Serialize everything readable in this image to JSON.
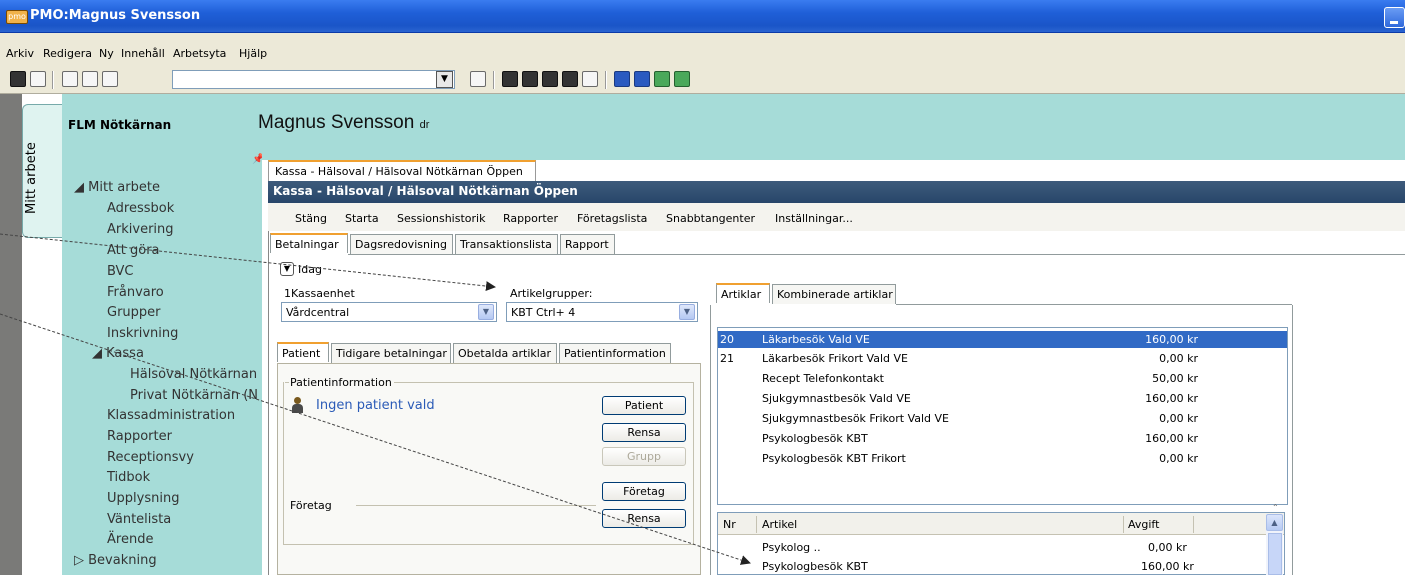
{
  "window": {
    "title": "PMO:Magnus Svensson",
    "icon_text": "pmo"
  },
  "menubar": [
    "Arkiv",
    "Redigera",
    "Ny",
    "Innehåll",
    "Arbetsyta",
    "Hjälp"
  ],
  "side_tab": {
    "label": "Mitt arbete"
  },
  "nav": {
    "header": "FLM Nötkärnan",
    "items": [
      "Mitt arbete",
      "Adressbok",
      "Arkivering",
      "Att göra",
      "BVC",
      "Frånvaro",
      "Grupper",
      "Inskrivning",
      "Kassa",
      "Hälsoval Nötkärnan",
      "Privat Nötkärnan (N",
      "Klassadministration",
      "Rapporter",
      "Receptionsvy",
      "Tidbok",
      "Upplysning",
      "Väntelista",
      "Ärende",
      "Bevakning"
    ]
  },
  "banner": {
    "name": "Magnus Svensson",
    "suffix": "dr"
  },
  "content": {
    "window_tab": "Kassa - Hälsoval / Hälsoval Nötkärnan Öppen",
    "window_title": "Kassa - Hälsoval / Hälsoval Nötkärnan Öppen",
    "menu": [
      "Stäng",
      "Starta",
      "Sessionshistorik",
      "Rapporter",
      "Företagslista",
      "Snabbtangenter",
      "Inställningar..."
    ],
    "tabs": [
      "Betalningar",
      "Dagsredovisning",
      "Transaktionslista",
      "Rapport"
    ],
    "idag_label": "Idag",
    "kassaenhet_label": "1Kassaenhet",
    "kassaenhet_value": "Vårdcentral",
    "artikelgrupper_label": "Artikelgrupper:",
    "artikelgrupper_value": "KBT Ctrl+ 4",
    "patient_tabs": [
      "Patient",
      "Tidigare betalningar",
      "Obetalda artiklar",
      "Patientinformation"
    ],
    "patient_group_label": "Patientinformation",
    "no_patient": "Ingen patient vald",
    "buttons": {
      "patient": "Patient",
      "rensa1": "Rensa",
      "grupp": "Grupp",
      "foretag": "Företag",
      "rensa2": "Rensa"
    },
    "foretag_label": "Företag",
    "article_tabs": [
      "Artiklar",
      "Kombinerade artiklar"
    ],
    "articles": [
      {
        "nr": "20",
        "name": "Läkarbesök Vald VE",
        "price": "160,00 kr"
      },
      {
        "nr": "21",
        "name": "Läkarbesök Frikort Vald VE",
        "price": "0,00 kr"
      },
      {
        "nr": "",
        "name": "Recept Telefonkontakt",
        "price": "50,00 kr"
      },
      {
        "nr": "",
        "name": "Sjukgymnastbesök Vald VE",
        "price": "160,00 kr"
      },
      {
        "nr": "",
        "name": "Sjukgymnastbesök Frikort Vald VE",
        "price": "0,00 kr"
      },
      {
        "nr": "",
        "name": "Psykologbesök KBT",
        "price": "160,00 kr"
      },
      {
        "nr": "",
        "name": "Psykologbesök KBT Frikort",
        "price": "0,00 kr"
      }
    ],
    "lower_headers": [
      "Nr",
      "Artikel",
      "Avgift"
    ],
    "lower_rows": [
      {
        "name": "Psykolog ..",
        "price": "0,00 kr"
      },
      {
        "name": "Psykologbesök KBT",
        "price": "160,00 kr"
      }
    ]
  }
}
